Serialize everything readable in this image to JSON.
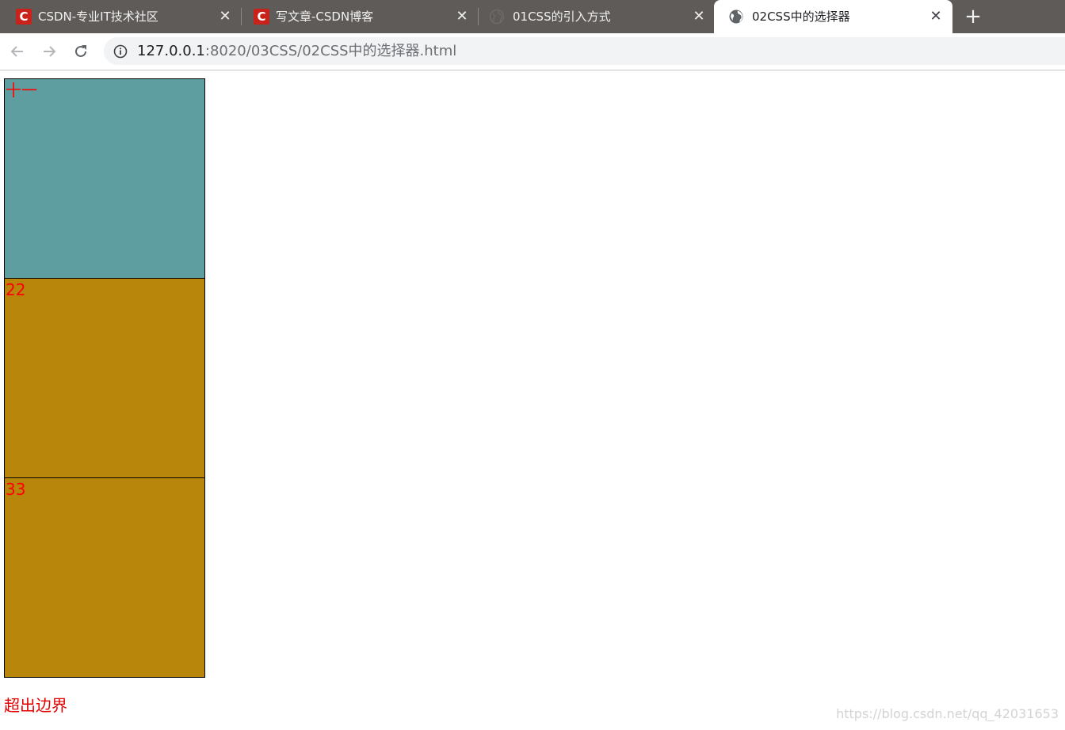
{
  "browser": {
    "tabs": [
      {
        "title": "CSDN-专业IT技术社区",
        "icon": "csdn-logo-icon",
        "active": false
      },
      {
        "title": "写文章-CSDN博客",
        "icon": "csdn-logo-icon",
        "active": false
      },
      {
        "title": "01CSS的引入方式",
        "icon": "globe-icon",
        "active": false
      },
      {
        "title": "02CSS中的选择器",
        "icon": "globe-icon",
        "active": true
      }
    ],
    "close_glyph": "✕",
    "new_tab_glyph": "+",
    "favicon_letter": "C",
    "url": {
      "host": "127.0.0.1",
      "rest": ":8020/03CSS/02CSS中的选择器.html"
    }
  },
  "page": {
    "boxes": [
      {
        "label": "十一",
        "color": "#5f9ea0"
      },
      {
        "label": "22",
        "color": "#b8860b"
      },
      {
        "label": "33",
        "color": "#b8860b"
      }
    ],
    "overflow_text": "超出边界",
    "watermark": "https://blog.csdn.net/qq_42031653"
  },
  "colors": {
    "tabbar": "#5f5b58",
    "text_red": "#ff0000",
    "cadetblue": "#5f9ea0",
    "darkgoldenrod": "#b8860b"
  }
}
